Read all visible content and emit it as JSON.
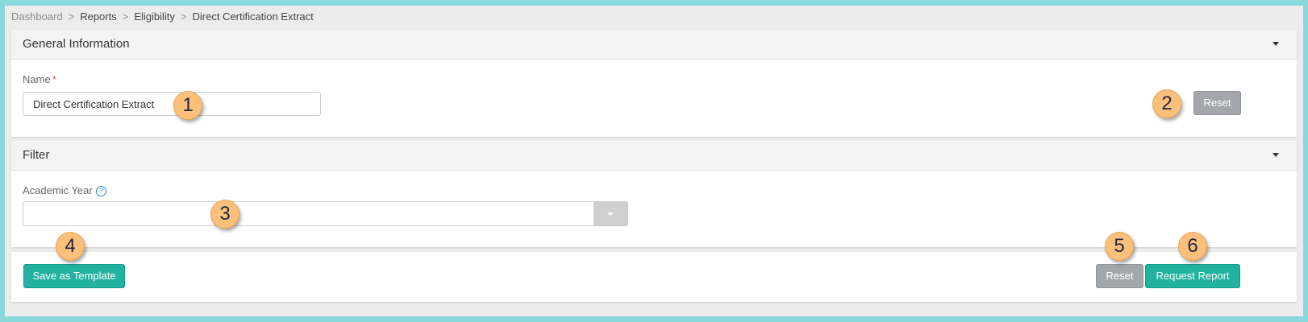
{
  "breadcrumb": {
    "items": [
      "Dashboard",
      "Reports",
      "Eligibility",
      "Direct Certification Extract"
    ],
    "separator": ">"
  },
  "general_information": {
    "title": "General Information",
    "name_label": "Name",
    "required_mark": "*",
    "name_value": "Direct Certification Extract",
    "reset_label": "Reset"
  },
  "filter": {
    "title": "Filter",
    "academic_year_label": "Academic Year",
    "help_glyph": "?",
    "academic_year_value": ""
  },
  "footer": {
    "save_template_label": "Save as Template",
    "reset_label": "Reset",
    "request_report_label": "Request Report"
  },
  "callouts": [
    "1",
    "2",
    "3",
    "4",
    "5",
    "6"
  ],
  "colors": {
    "frame_border": "#88d8dc",
    "teal_button": "#21b2a0",
    "gray_button": "#a3a7ab",
    "callout_fill": "#fcc07a"
  }
}
